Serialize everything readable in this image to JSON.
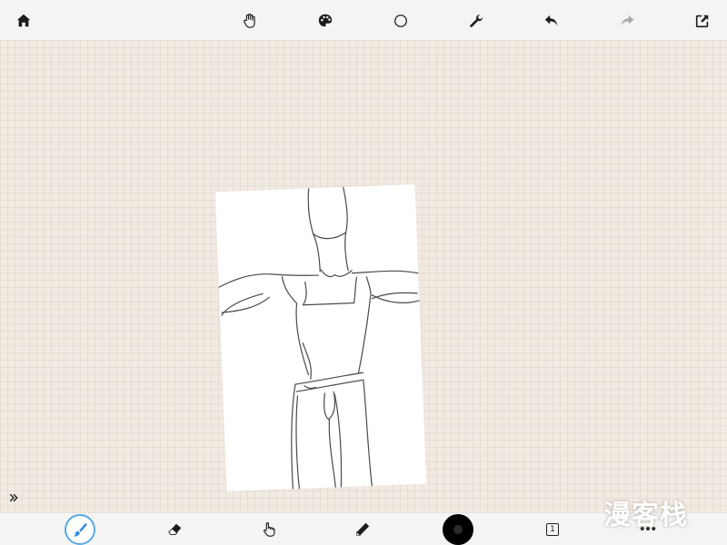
{
  "top_toolbar": {
    "icons": [
      "home-icon",
      "hand-icon",
      "palette-icon",
      "circle-icon",
      "wrench-icon",
      "undo-icon",
      "redo-icon",
      "share-icon"
    ]
  },
  "canvas": {
    "background_color": "#f2ebe3",
    "grid_color": "#e7ddd3",
    "paper_color": "#ffffff"
  },
  "bottom_toolbar": {
    "icons": [
      "brush-icon",
      "eraser-icon",
      "smudge-hand-icon",
      "pencil-icon",
      "color-icon",
      "layers-icon",
      "more-icon"
    ],
    "active_tool": "brush",
    "active_color": "#000000",
    "layer_count": "1",
    "more_label": "•••"
  },
  "accent_color": "#58a9e6",
  "watermark": {
    "text": "漫客栈"
  }
}
